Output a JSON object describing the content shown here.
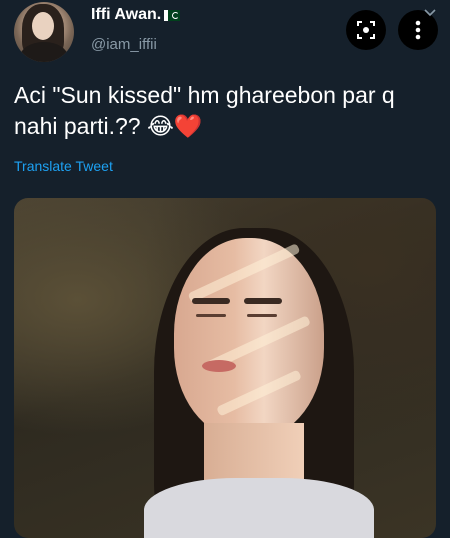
{
  "user": {
    "name": "Iffi Awan.",
    "flag_icon": "pakistan-flag-icon",
    "handle": "@iam_iffii"
  },
  "header_actions": {
    "scan_icon": "scan-icon",
    "more_icon": "more-vertical-icon",
    "chevron_icon": "chevron-down-icon"
  },
  "tweet": {
    "text": "Aci \"Sun kissed\" hm ghareebon par q nahi parti.?? 😂❤️",
    "translate_label": "Translate Tweet"
  },
  "colors": {
    "background": "#15202b",
    "link": "#1da1f2",
    "secondary_text": "#8899a6"
  }
}
